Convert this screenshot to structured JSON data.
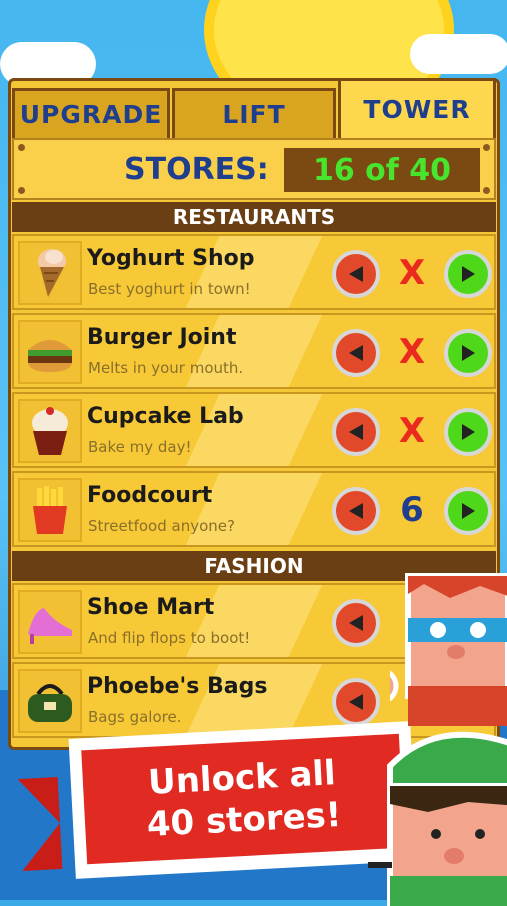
{
  "tabs": [
    {
      "label": "UPGRADE",
      "active": false
    },
    {
      "label": "LIFT",
      "active": false
    },
    {
      "label": "TOWER",
      "active": true
    }
  ],
  "stores": {
    "label": "STORES:",
    "count": "16 of 40"
  },
  "sections": [
    {
      "title": "RESTAURANTS",
      "items": [
        {
          "name": "Yoghurt Shop",
          "description": "Best yoghurt in town!",
          "status": "X",
          "icon": "frozen-yoghurt-icon"
        },
        {
          "name": "Burger Joint",
          "description": "Melts in your mouth.",
          "status": "X",
          "icon": "burger-icon"
        },
        {
          "name": "Cupcake Lab",
          "description": "Bake my day!",
          "status": "X",
          "icon": "cupcake-icon"
        },
        {
          "name": "Foodcourt",
          "description": "Streetfood anyone?",
          "status": "6",
          "icon": "fries-icon"
        }
      ]
    },
    {
      "title": "FASHION",
      "items": [
        {
          "name": "Shoe Mart",
          "description": "And flip flops to boot!",
          "status": "",
          "icon": "high-heel-icon"
        },
        {
          "name": "Phoebe's Bags",
          "description": "Bags galore.",
          "status": "",
          "icon": "handbag-icon"
        }
      ]
    }
  ],
  "promo": {
    "line1": "Unlock all",
    "line2": "40 stores!"
  },
  "colors": {
    "accent_blue": "#1f3f8e",
    "count_green": "#48e42e",
    "locked_red": "#ea2a1f",
    "banner_red": "#e02a22"
  }
}
